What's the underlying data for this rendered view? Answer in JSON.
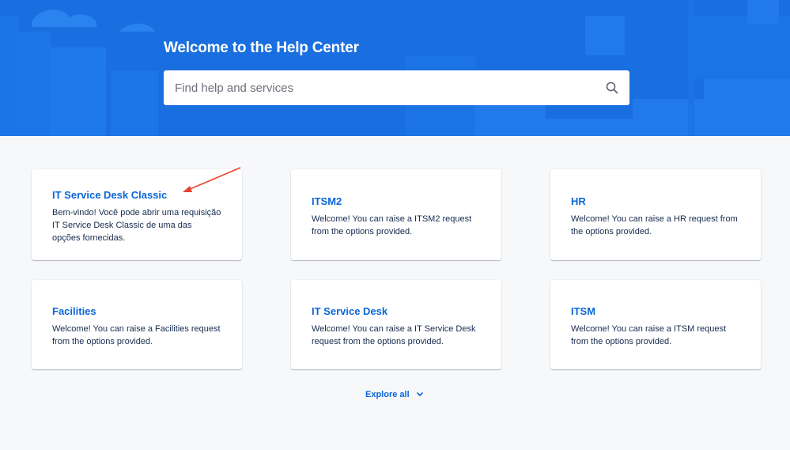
{
  "hero": {
    "title": "Welcome to the Help Center",
    "background_color": "#1a6fe0"
  },
  "search": {
    "placeholder": "Find help and services",
    "icon": "search-icon"
  },
  "cards": [
    {
      "title": "IT Service Desk Classic",
      "description": "Bem-vindo! Você pode abrir uma requisição IT Service Desk Classic de uma das opções fornecidas."
    },
    {
      "title": "ITSM2",
      "description": "Welcome! You can raise a ITSM2 request from the options provided."
    },
    {
      "title": "HR",
      "description": "Welcome! You can raise a HR request from the options provided."
    },
    {
      "title": "Facilities",
      "description": "Welcome! You can raise a Facilities request from the options provided."
    },
    {
      "title": "IT Service Desk",
      "description": "Welcome! You can raise a IT Service Desk request from the options provided."
    },
    {
      "title": "ITSM",
      "description": "Welcome! You can raise a ITSM request from the options provided."
    }
  ],
  "explore": {
    "label": "Explore all",
    "icon": "chevron-down-icon"
  },
  "annotation": {
    "icon": "red-arrow-icon",
    "color": "#e8432e"
  },
  "colors": {
    "link": "#0a66d8",
    "text": "#172b4d",
    "page_background": "#f7f8fa"
  }
}
